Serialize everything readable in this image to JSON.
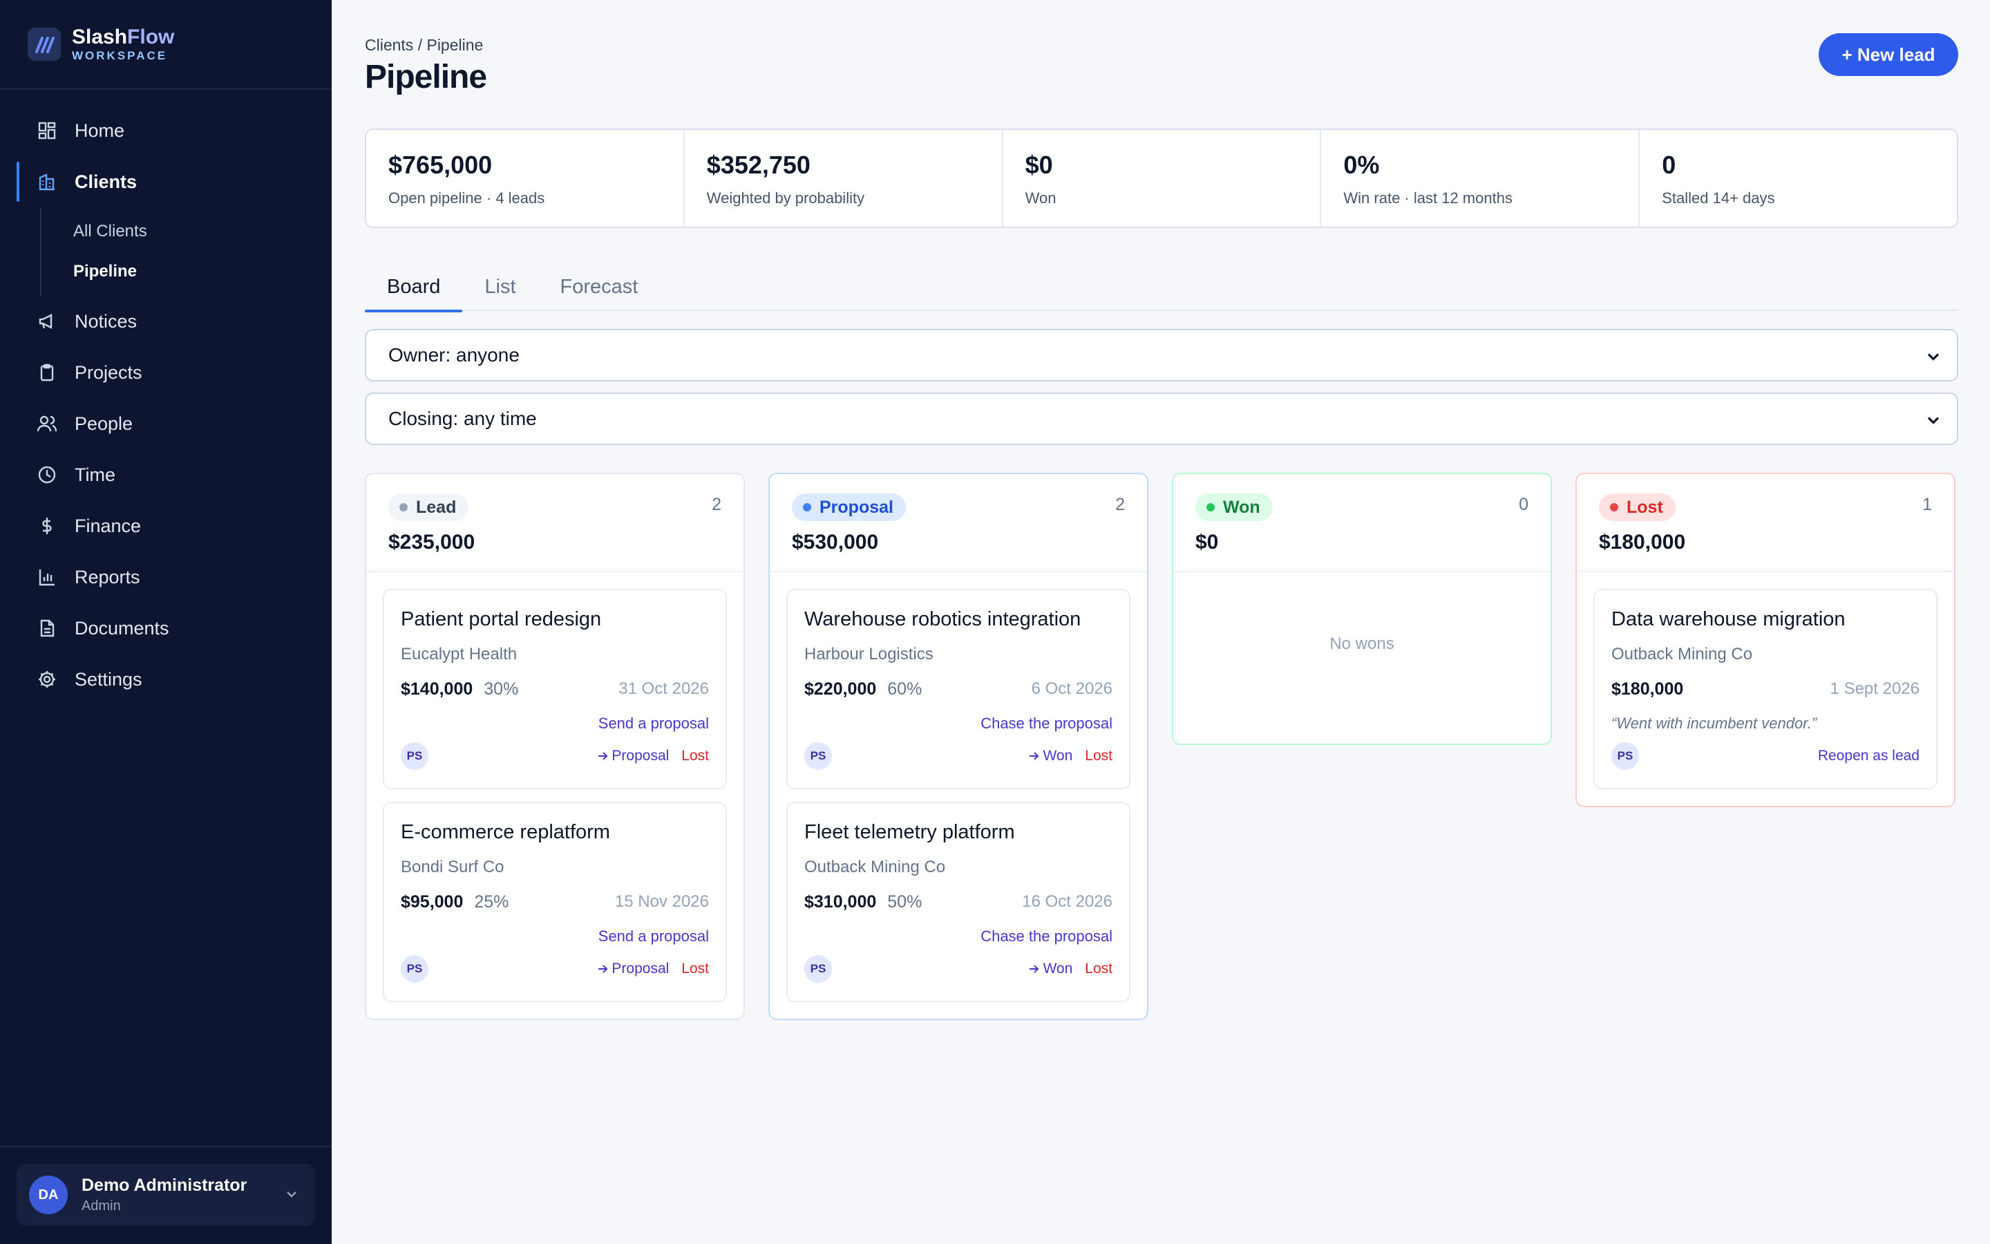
{
  "brand": {
    "name_a": "Slash",
    "name_b": "Flow",
    "sub": "WORKSPACE"
  },
  "nav": {
    "home": "Home",
    "clients": "Clients",
    "clients_sub": {
      "all": "All Clients",
      "pipeline": "Pipeline"
    },
    "notices": "Notices",
    "projects": "Projects",
    "people": "People",
    "time": "Time",
    "finance": "Finance",
    "reports": "Reports",
    "documents": "Documents",
    "settings": "Settings"
  },
  "user": {
    "initials": "DA",
    "name": "Demo Administrator",
    "role": "Admin"
  },
  "header": {
    "breadcrumb": "Clients / Pipeline",
    "title": "Pipeline",
    "new_lead_label": "+ New lead"
  },
  "stats": [
    {
      "value": "$765,000",
      "label": "Open pipeline · 4 leads"
    },
    {
      "value": "$352,750",
      "label": "Weighted by probability"
    },
    {
      "value": "$0",
      "label": "Won"
    },
    {
      "value": "0%",
      "label": "Win rate · last 12 months"
    },
    {
      "value": "0",
      "label": "Stalled 14+ days"
    }
  ],
  "tabs": {
    "board": "Board",
    "list": "List",
    "forecast": "Forecast"
  },
  "filters": {
    "owner": "Owner: anyone",
    "closing": "Closing: any time"
  },
  "columns": {
    "lead": {
      "label": "Lead",
      "count": "2",
      "total": "$235,000",
      "cards": [
        {
          "title": "Patient portal redesign",
          "client": "Eucalypt Health",
          "amount": "$140,000",
          "prob": "30%",
          "date": "31 Oct 2026",
          "next": "Send a proposal",
          "owner": "PS",
          "move": "Proposal",
          "lost": "Lost"
        },
        {
          "title": "E-commerce replatform",
          "client": "Bondi Surf Co",
          "amount": "$95,000",
          "prob": "25%",
          "date": "15 Nov 2026",
          "next": "Send a proposal",
          "owner": "PS",
          "move": "Proposal",
          "lost": "Lost"
        }
      ]
    },
    "proposal": {
      "label": "Proposal",
      "count": "2",
      "total": "$530,000",
      "cards": [
        {
          "title": "Warehouse robotics integration",
          "client": "Harbour Logistics",
          "amount": "$220,000",
          "prob": "60%",
          "date": "6 Oct 2026",
          "next": "Chase the proposal",
          "owner": "PS",
          "move": "Won",
          "lost": "Lost"
        },
        {
          "title": "Fleet telemetry platform",
          "client": "Outback Mining Co",
          "amount": "$310,000",
          "prob": "50%",
          "date": "16 Oct 2026",
          "next": "Chase the proposal",
          "owner": "PS",
          "move": "Won",
          "lost": "Lost"
        }
      ]
    },
    "won": {
      "label": "Won",
      "count": "0",
      "total": "$0",
      "empty": "No wons"
    },
    "lost": {
      "label": "Lost",
      "count": "1",
      "total": "$180,000",
      "cards": [
        {
          "title": "Data warehouse migration",
          "client": "Outback Mining Co",
          "amount": "$180,000",
          "date": "1 Sept 2026",
          "note": "“Went with incumbent vendor.”",
          "owner": "PS",
          "reopen": "Reopen as lead"
        }
      ]
    }
  },
  "colors": {
    "accent": "#2f5bea",
    "sidebar": "#0d1530",
    "lost": "#dc2626",
    "won": "#15803d"
  }
}
